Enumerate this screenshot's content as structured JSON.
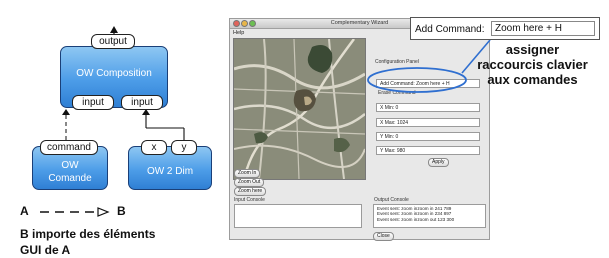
{
  "diagram": {
    "output_label": "output",
    "composition_title_1": "OW Composition",
    "input_left_label": "input",
    "input_right_label": "input",
    "command_label": "command",
    "comande_title_1": "OW",
    "comande_title_2": "Comande",
    "x_label": "x",
    "y_label": "y",
    "dim_title": "OW 2 Dim",
    "legend_a": "A",
    "legend_b": "B",
    "note_line_1": "B importe des éléments",
    "note_line_2": "GUI de A"
  },
  "window": {
    "title": "Complementary Wizard",
    "menu": "Help",
    "buttons": {
      "zoom_in": "Zoom In",
      "zoom_out": "Zoom Out",
      "zoom_here": "Zoom here",
      "apply": "Apply",
      "close": "Close"
    },
    "group_label": "Configuration Panel",
    "add_command_field": "Add Command:  Zoom here + H",
    "erase_command_label": "Erase Command",
    "fields": [
      {
        "text": "X Min:  0"
      },
      {
        "text": "X Max:  1024"
      },
      {
        "text": "Y Min:  0"
      },
      {
        "text": "Y Max:  980"
      }
    ],
    "input_console_label": "Input Console",
    "output_console_label": "Output Console",
    "output_lines": [
      "Event sent: zoom inzoom in 241 789",
      "Event sent: zoom inzoom in 234 897",
      "Event sent: zoom inzoom out 123 300"
    ]
  },
  "callout": {
    "label": "Add Command:",
    "value": "Zoom here + H",
    "caption_1": "assigner",
    "caption_2": "raccourcis clavier",
    "caption_3": "aux comandes"
  }
}
